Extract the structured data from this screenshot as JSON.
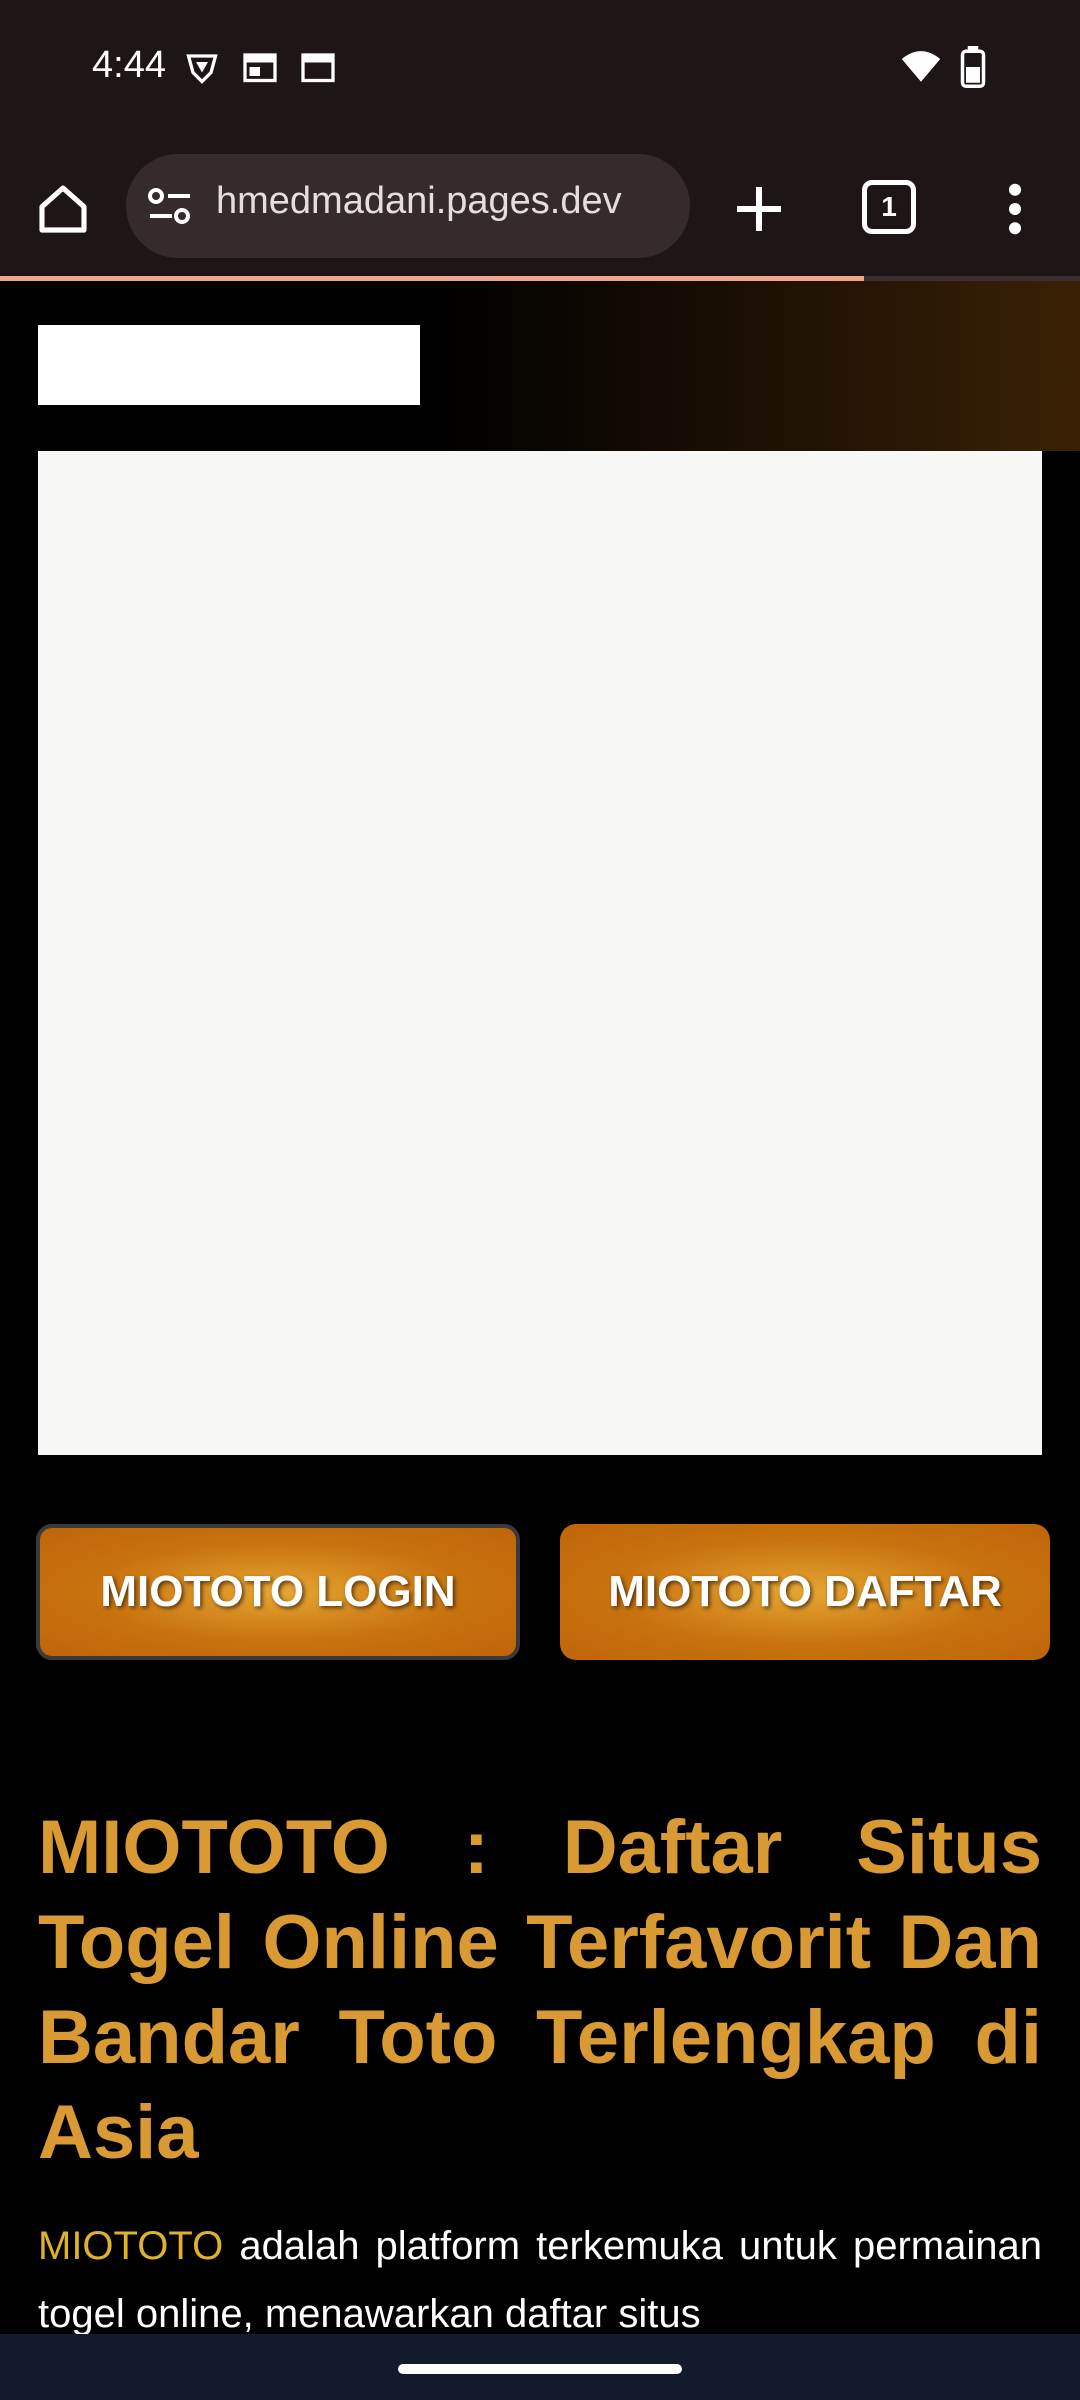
{
  "status_bar": {
    "time": "4:44",
    "icons": [
      "vpn-shield-icon",
      "calendar-icon",
      "calendar-icon",
      "wifi-icon",
      "battery-icon"
    ]
  },
  "browser": {
    "url": "hmedmadani.pages.dev",
    "tab_count": "1",
    "load_progress": 0.8,
    "colors": {
      "progress": "#f2a58a",
      "toolbar": "#1e1516"
    }
  },
  "page": {
    "buttons": {
      "login": "MIOTOTO LOGIN",
      "daftar": "MIOTOTO DAFTAR"
    },
    "headline": "MIOTOTO : Daftar Situs Togel Online Terfavorit Dan Bandar Toto Terlengkap di Asia",
    "paragraph": {
      "brand": "MIOTOTO",
      "text": " adalah platform terkemuka untuk permainan togel online, menawarkan daftar situs"
    },
    "colors": {
      "accent": "#d99a33",
      "button": "#c8720f"
    }
  }
}
